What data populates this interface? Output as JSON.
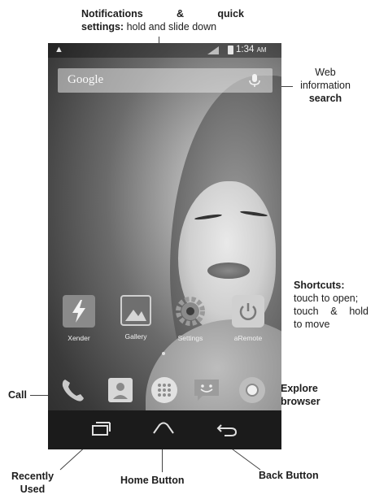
{
  "annotations": {
    "notifications_bold": "Notifications & quick settings:",
    "notifications_line1_a": "Notifications",
    "notifications_line1_b": "&",
    "notifications_line1_c": "quick",
    "notifications_line2_bold": "settings:",
    "notifications_line2_rest": "hold and slide down",
    "web_line1": "Web",
    "web_line2": "information",
    "web_line3": "search",
    "shortcuts_bold": "Shortcuts:",
    "shortcuts_line2": "touch to open;",
    "shortcuts_line3_a": "touch",
    "shortcuts_line3_b": "&",
    "shortcuts_line3_c": "hold",
    "shortcuts_line4": "to move",
    "call": "Call",
    "explore_line1": "Explore",
    "explore_line2": "browser",
    "recently_line1": "Recently",
    "recently_line2": "Used",
    "home_button": "Home Button",
    "back_button": "Back Button"
  },
  "status_bar": {
    "warning_icon": "warning-icon",
    "time": "1:34",
    "ampm": "AM"
  },
  "search_bar": {
    "placeholder": "Google",
    "mic_icon": "microphone-icon"
  },
  "apps": [
    {
      "label": "Xender",
      "icon": "lightning-icon"
    },
    {
      "label": "Gallery",
      "icon": "gallery-icon"
    },
    {
      "label": "Settings",
      "icon": "gear-icon"
    },
    {
      "label": "aRemote",
      "icon": "power-icon"
    }
  ],
  "dock": [
    "phone-icon",
    "contacts-icon",
    "app-drawer-icon",
    "messaging-icon",
    "browser-icon"
  ],
  "navbar": [
    "recent-apps-icon",
    "home-icon",
    "back-icon"
  ]
}
